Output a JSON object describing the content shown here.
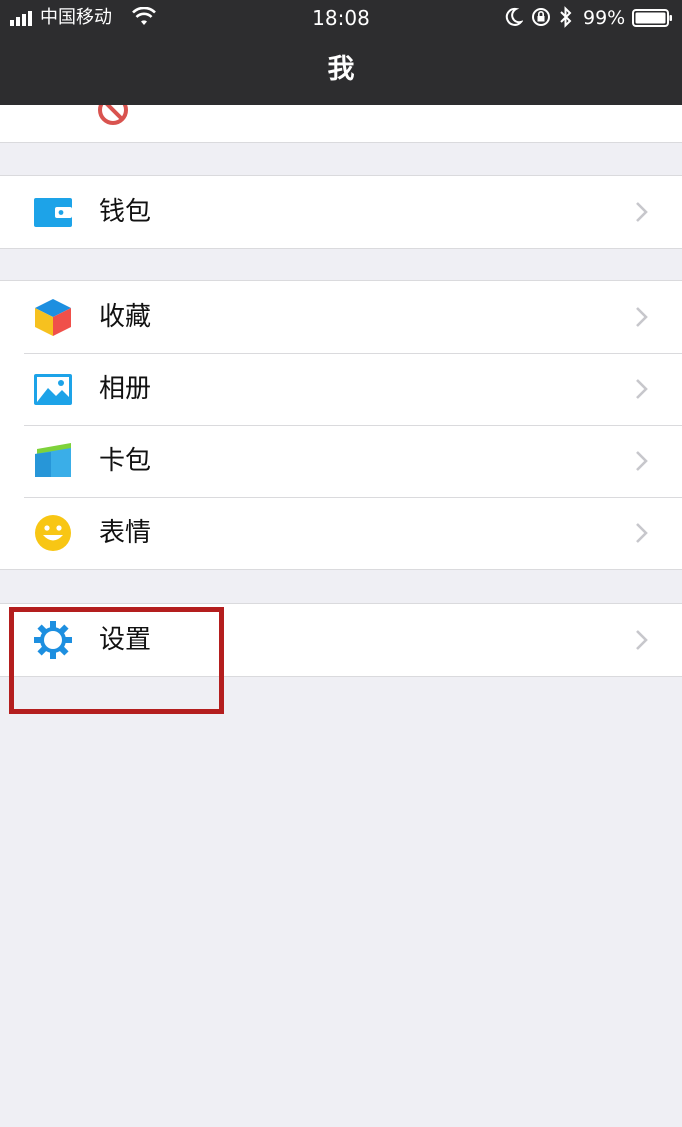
{
  "status_bar": {
    "carrier": "中国移动",
    "time": "18:08",
    "battery_percent": "99%",
    "icons": [
      "signal-icon",
      "wifi-icon",
      "moon-icon",
      "rotation-lock-icon",
      "bluetooth-icon",
      "battery-icon"
    ]
  },
  "nav": {
    "title": "我"
  },
  "groups": [
    {
      "items": [
        {
          "label": "钱包",
          "icon": "wallet-icon"
        }
      ]
    },
    {
      "items": [
        {
          "label": "收藏",
          "icon": "favorites-cube-icon"
        },
        {
          "label": "相册",
          "icon": "album-picture-icon"
        },
        {
          "label": "卡包",
          "icon": "card-wallet-icon"
        },
        {
          "label": "表情",
          "icon": "smiley-icon"
        }
      ]
    },
    {
      "items": [
        {
          "label": "设置",
          "icon": "gear-icon"
        }
      ]
    }
  ],
  "colors": {
    "nav_background": "#2d2d2f",
    "page_background": "#efeff4",
    "icon_blue": "#1e9ee6",
    "highlight_red": "#b41e1e"
  }
}
